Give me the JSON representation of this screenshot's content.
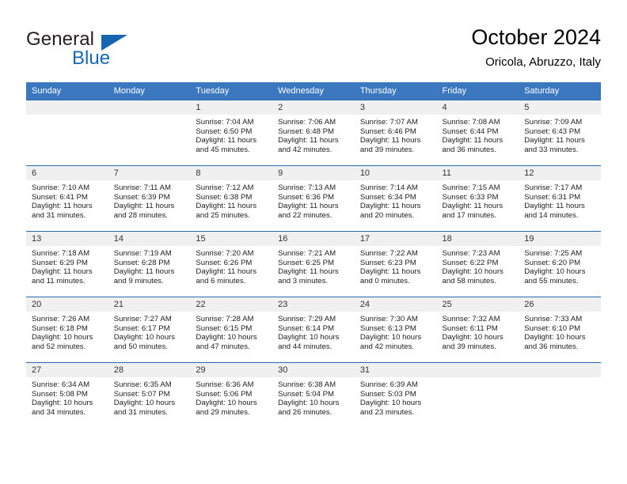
{
  "brand": {
    "name_top": "General",
    "name_bottom": "Blue",
    "accent_color": "#1568b3"
  },
  "header": {
    "title": "October 2024",
    "subtitle": "Oricola, Abruzzo, Italy"
  },
  "calendar": {
    "header_bg": "#3b78bf",
    "weekday_headers": [
      "Sunday",
      "Monday",
      "Tuesday",
      "Wednesday",
      "Thursday",
      "Friday",
      "Saturday"
    ],
    "weeks": [
      [
        {
          "day": "",
          "sunrise": "",
          "sunset": "",
          "daylight_line1": "",
          "daylight_line2": ""
        },
        {
          "day": "",
          "sunrise": "",
          "sunset": "",
          "daylight_line1": "",
          "daylight_line2": ""
        },
        {
          "day": "1",
          "sunrise": "Sunrise: 7:04 AM",
          "sunset": "Sunset: 6:50 PM",
          "daylight_line1": "Daylight: 11 hours",
          "daylight_line2": "and 45 minutes."
        },
        {
          "day": "2",
          "sunrise": "Sunrise: 7:06 AM",
          "sunset": "Sunset: 6:48 PM",
          "daylight_line1": "Daylight: 11 hours",
          "daylight_line2": "and 42 minutes."
        },
        {
          "day": "3",
          "sunrise": "Sunrise: 7:07 AM",
          "sunset": "Sunset: 6:46 PM",
          "daylight_line1": "Daylight: 11 hours",
          "daylight_line2": "and 39 minutes."
        },
        {
          "day": "4",
          "sunrise": "Sunrise: 7:08 AM",
          "sunset": "Sunset: 6:44 PM",
          "daylight_line1": "Daylight: 11 hours",
          "daylight_line2": "and 36 minutes."
        },
        {
          "day": "5",
          "sunrise": "Sunrise: 7:09 AM",
          "sunset": "Sunset: 6:43 PM",
          "daylight_line1": "Daylight: 11 hours",
          "daylight_line2": "and 33 minutes."
        }
      ],
      [
        {
          "day": "6",
          "sunrise": "Sunrise: 7:10 AM",
          "sunset": "Sunset: 6:41 PM",
          "daylight_line1": "Daylight: 11 hours",
          "daylight_line2": "and 31 minutes."
        },
        {
          "day": "7",
          "sunrise": "Sunrise: 7:11 AM",
          "sunset": "Sunset: 6:39 PM",
          "daylight_line1": "Daylight: 11 hours",
          "daylight_line2": "and 28 minutes."
        },
        {
          "day": "8",
          "sunrise": "Sunrise: 7:12 AM",
          "sunset": "Sunset: 6:38 PM",
          "daylight_line1": "Daylight: 11 hours",
          "daylight_line2": "and 25 minutes."
        },
        {
          "day": "9",
          "sunrise": "Sunrise: 7:13 AM",
          "sunset": "Sunset: 6:36 PM",
          "daylight_line1": "Daylight: 11 hours",
          "daylight_line2": "and 22 minutes."
        },
        {
          "day": "10",
          "sunrise": "Sunrise: 7:14 AM",
          "sunset": "Sunset: 6:34 PM",
          "daylight_line1": "Daylight: 11 hours",
          "daylight_line2": "and 20 minutes."
        },
        {
          "day": "11",
          "sunrise": "Sunrise: 7:15 AM",
          "sunset": "Sunset: 6:33 PM",
          "daylight_line1": "Daylight: 11 hours",
          "daylight_line2": "and 17 minutes."
        },
        {
          "day": "12",
          "sunrise": "Sunrise: 7:17 AM",
          "sunset": "Sunset: 6:31 PM",
          "daylight_line1": "Daylight: 11 hours",
          "daylight_line2": "and 14 minutes."
        }
      ],
      [
        {
          "day": "13",
          "sunrise": "Sunrise: 7:18 AM",
          "sunset": "Sunset: 6:29 PM",
          "daylight_line1": "Daylight: 11 hours",
          "daylight_line2": "and 11 minutes."
        },
        {
          "day": "14",
          "sunrise": "Sunrise: 7:19 AM",
          "sunset": "Sunset: 6:28 PM",
          "daylight_line1": "Daylight: 11 hours",
          "daylight_line2": "and 9 minutes."
        },
        {
          "day": "15",
          "sunrise": "Sunrise: 7:20 AM",
          "sunset": "Sunset: 6:26 PM",
          "daylight_line1": "Daylight: 11 hours",
          "daylight_line2": "and 6 minutes."
        },
        {
          "day": "16",
          "sunrise": "Sunrise: 7:21 AM",
          "sunset": "Sunset: 6:25 PM",
          "daylight_line1": "Daylight: 11 hours",
          "daylight_line2": "and 3 minutes."
        },
        {
          "day": "17",
          "sunrise": "Sunrise: 7:22 AM",
          "sunset": "Sunset: 6:23 PM",
          "daylight_line1": "Daylight: 11 hours",
          "daylight_line2": "and 0 minutes."
        },
        {
          "day": "18",
          "sunrise": "Sunrise: 7:23 AM",
          "sunset": "Sunset: 6:22 PM",
          "daylight_line1": "Daylight: 10 hours",
          "daylight_line2": "and 58 minutes."
        },
        {
          "day": "19",
          "sunrise": "Sunrise: 7:25 AM",
          "sunset": "Sunset: 6:20 PM",
          "daylight_line1": "Daylight: 10 hours",
          "daylight_line2": "and 55 minutes."
        }
      ],
      [
        {
          "day": "20",
          "sunrise": "Sunrise: 7:26 AM",
          "sunset": "Sunset: 6:18 PM",
          "daylight_line1": "Daylight: 10 hours",
          "daylight_line2": "and 52 minutes."
        },
        {
          "day": "21",
          "sunrise": "Sunrise: 7:27 AM",
          "sunset": "Sunset: 6:17 PM",
          "daylight_line1": "Daylight: 10 hours",
          "daylight_line2": "and 50 minutes."
        },
        {
          "day": "22",
          "sunrise": "Sunrise: 7:28 AM",
          "sunset": "Sunset: 6:15 PM",
          "daylight_line1": "Daylight: 10 hours",
          "daylight_line2": "and 47 minutes."
        },
        {
          "day": "23",
          "sunrise": "Sunrise: 7:29 AM",
          "sunset": "Sunset: 6:14 PM",
          "daylight_line1": "Daylight: 10 hours",
          "daylight_line2": "and 44 minutes."
        },
        {
          "day": "24",
          "sunrise": "Sunrise: 7:30 AM",
          "sunset": "Sunset: 6:13 PM",
          "daylight_line1": "Daylight: 10 hours",
          "daylight_line2": "and 42 minutes."
        },
        {
          "day": "25",
          "sunrise": "Sunrise: 7:32 AM",
          "sunset": "Sunset: 6:11 PM",
          "daylight_line1": "Daylight: 10 hours",
          "daylight_line2": "and 39 minutes."
        },
        {
          "day": "26",
          "sunrise": "Sunrise: 7:33 AM",
          "sunset": "Sunset: 6:10 PM",
          "daylight_line1": "Daylight: 10 hours",
          "daylight_line2": "and 36 minutes."
        }
      ],
      [
        {
          "day": "27",
          "sunrise": "Sunrise: 6:34 AM",
          "sunset": "Sunset: 5:08 PM",
          "daylight_line1": "Daylight: 10 hours",
          "daylight_line2": "and 34 minutes."
        },
        {
          "day": "28",
          "sunrise": "Sunrise: 6:35 AM",
          "sunset": "Sunset: 5:07 PM",
          "daylight_line1": "Daylight: 10 hours",
          "daylight_line2": "and 31 minutes."
        },
        {
          "day": "29",
          "sunrise": "Sunrise: 6:36 AM",
          "sunset": "Sunset: 5:06 PM",
          "daylight_line1": "Daylight: 10 hours",
          "daylight_line2": "and 29 minutes."
        },
        {
          "day": "30",
          "sunrise": "Sunrise: 6:38 AM",
          "sunset": "Sunset: 5:04 PM",
          "daylight_line1": "Daylight: 10 hours",
          "daylight_line2": "and 26 minutes."
        },
        {
          "day": "31",
          "sunrise": "Sunrise: 6:39 AM",
          "sunset": "Sunset: 5:03 PM",
          "daylight_line1": "Daylight: 10 hours",
          "daylight_line2": "and 23 minutes."
        },
        {
          "day": "",
          "sunrise": "",
          "sunset": "",
          "daylight_line1": "",
          "daylight_line2": ""
        },
        {
          "day": "",
          "sunrise": "",
          "sunset": "",
          "daylight_line1": "",
          "daylight_line2": ""
        }
      ]
    ]
  }
}
